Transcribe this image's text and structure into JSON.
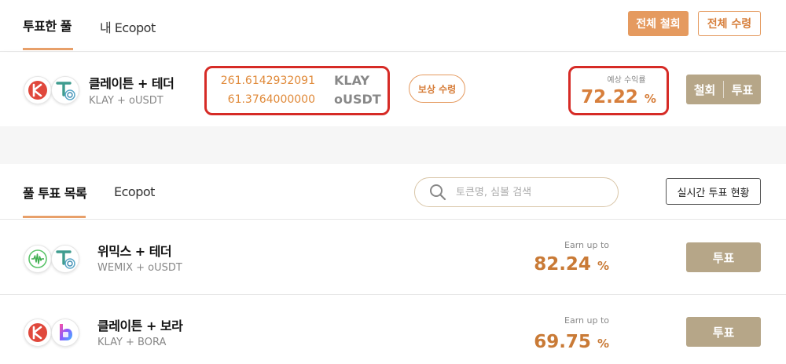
{
  "top_tabs": {
    "vote_pool": "투표한 풀",
    "my_ecopot": "내 Ecopot"
  },
  "actions": {
    "withdraw_all": "전체 철회",
    "claim_all": "전체 수령"
  },
  "my_pool": {
    "name": "클레이튼 + 테더",
    "symbols": "KLAY + oUSDT",
    "amount1": "261.6142932091",
    "unit1": "KLAY",
    "amount2": "61.3764000000",
    "unit2": "oUSDT",
    "reward_button": "보상 수령",
    "yield_label": "예상 수익률",
    "yield_value": "72.22",
    "yield_unit": "%",
    "withdraw_label": "철회",
    "vote_label": "투표"
  },
  "list_tabs": {
    "pool_vote_list": "풀 투표 목록",
    "ecopot": "Ecopot"
  },
  "search": {
    "placeholder": "토큰명, 심볼 검색"
  },
  "realtime_button": "실시간 투표 현황",
  "pools": [
    {
      "name": "위믹스 + 테더",
      "symbols": "WEMIX + oUSDT",
      "earn_label": "Earn up to",
      "earn_value": "82.24",
      "earn_unit": "%",
      "vote_label": "투표"
    },
    {
      "name": "클레이튼 + 보라",
      "symbols": "KLAY + BORA",
      "earn_label": "Earn up to",
      "earn_value": "69.75",
      "earn_unit": "%",
      "vote_label": "투표"
    }
  ],
  "colors": {
    "accent": "#e59a5f",
    "highlight_red": "#d62b26",
    "vote_button": "#b6a688",
    "value_orange": "#d77f3c"
  },
  "icons": [
    "klaytn-icon",
    "tether-icon",
    "wemix-icon",
    "bora-icon",
    "search-icon"
  ]
}
